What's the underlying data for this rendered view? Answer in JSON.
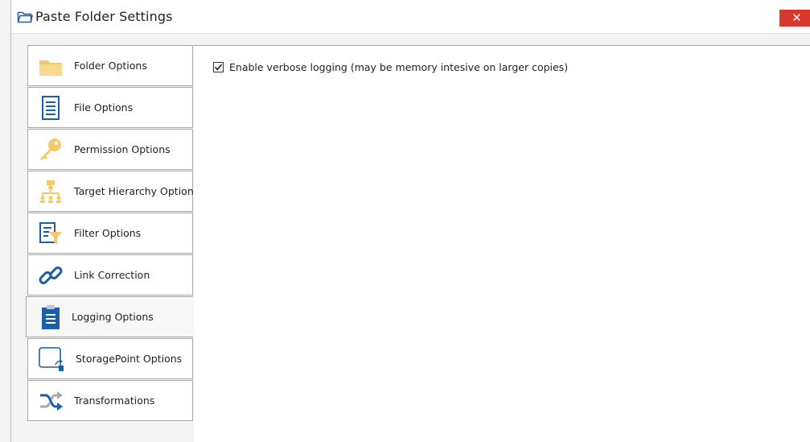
{
  "window": {
    "title": "Paste Folder Settings",
    "close_glyph": "✕"
  },
  "sidebar": {
    "items": [
      {
        "label": "Folder Options",
        "icon": "folder-icon"
      },
      {
        "label": "File Options",
        "icon": "file-icon"
      },
      {
        "label": "Permission Options",
        "icon": "key-icon"
      },
      {
        "label": "Target Hierarchy Options",
        "icon": "hierarchy-icon"
      },
      {
        "label": "Filter Options",
        "icon": "filter-icon"
      },
      {
        "label": "Link Correction",
        "icon": "link-icon"
      },
      {
        "label": "Logging Options",
        "icon": "clipboard-icon",
        "selected": true
      },
      {
        "label": "StoragePoint Options",
        "icon": "storagepoint-icon"
      },
      {
        "label": "Transformations",
        "icon": "shuffle-icon"
      }
    ]
  },
  "content": {
    "verbose_logging": {
      "label": "Enable verbose logging (may be memory intesive on larger copies)",
      "checked": true
    }
  },
  "colors": {
    "accent_blue": "#1b5fa8",
    "folder_yellow": "#f5c86a",
    "close_red": "#d8382b"
  }
}
